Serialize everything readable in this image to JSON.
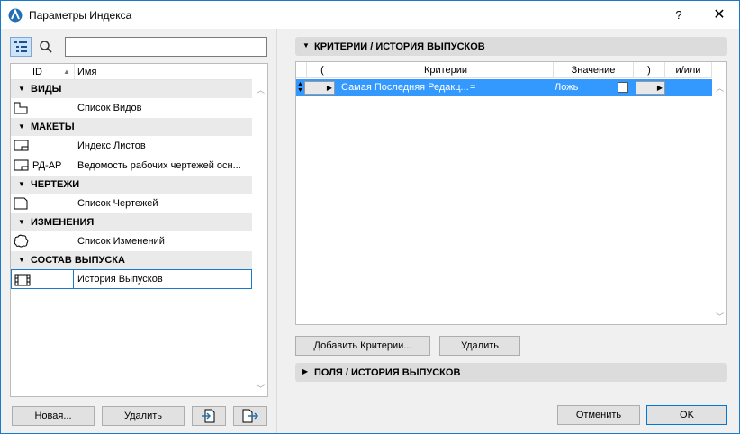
{
  "window": {
    "title": "Параметры Индекса",
    "help": "?",
    "close": "✕"
  },
  "left": {
    "search": {
      "placeholder": "",
      "value": ""
    },
    "columns": {
      "id": "ID",
      "name": "Имя"
    },
    "groups": [
      {
        "label": "ВИДЫ",
        "items": [
          {
            "icon": "view-list-icon",
            "id": "",
            "name": "Список Видов"
          }
        ]
      },
      {
        "label": "МАКЕТЫ",
        "items": [
          {
            "icon": "layout-index-icon",
            "id": "",
            "name": "Индекс Листов"
          },
          {
            "icon": "layout-index-icon",
            "id": "РД-АР",
            "name": "Ведомость рабочих чертежей осн..."
          }
        ]
      },
      {
        "label": "ЧЕРТЕЖИ",
        "items": [
          {
            "icon": "drawing-list-icon",
            "id": "",
            "name": "Список Чертежей"
          }
        ]
      },
      {
        "label": "ИЗМЕНЕНИЯ",
        "items": [
          {
            "icon": "change-cloud-icon",
            "id": "",
            "name": "Список Изменений"
          }
        ]
      },
      {
        "label": "СОСТАВ ВЫПУСКА",
        "items": [
          {
            "icon": "issue-history-icon",
            "id": "",
            "name": "История Выпусков"
          }
        ]
      }
    ],
    "buttons": {
      "new": "Новая...",
      "delete": "Удалить"
    }
  },
  "right": {
    "criteria_section": "КРИТЕРИИ /  ИСТОРИЯ ВЫПУСКОВ",
    "grid_columns": {
      "open": "(",
      "criteria": "Критерии",
      "value": "Значение",
      "close": ")",
      "andor": "и/или"
    },
    "row": {
      "criteria": "Самая Последняя Редакц...",
      "operator": "=",
      "value": "Ложь"
    },
    "buttons": {
      "add_criteria": "Добавить Критерии...",
      "delete": "Удалить",
      "cancel": "Отменить",
      "ok": "OK"
    },
    "fields_section": "ПОЛЯ /  ИСТОРИЯ ВЫПУСКОВ"
  },
  "colors": {
    "accent": "#1979ca",
    "selection": "#3399ff"
  }
}
